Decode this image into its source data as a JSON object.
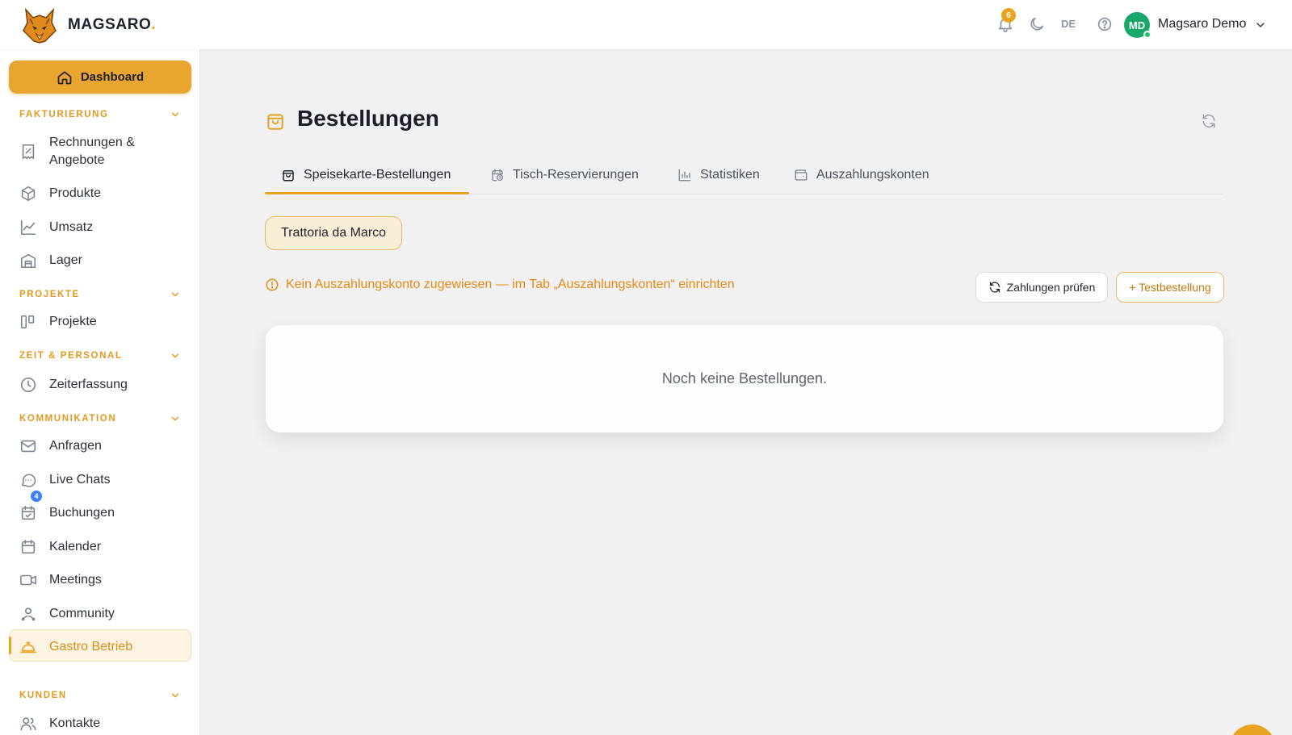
{
  "brand": {
    "name": "MAGSARO",
    "dot": ".",
    "logo_icon": "wolf-logo"
  },
  "topbar": {
    "notifications_count": "6",
    "language": "DE",
    "user_initials": "MD",
    "user_name": "Magsaro Demo"
  },
  "sidebar": {
    "dashboard_label": "Dashboard",
    "sections": {
      "fakturierung": "FAKTURIERUNG",
      "projekte": "PROJEKTE",
      "zeit": "ZEIT & PERSONAL",
      "kommunikation": "KOMMUNIKATION",
      "kunden": "KUNDEN"
    },
    "items": {
      "rechnungen_1": "Rechnungen &",
      "rechnungen_2": "Angebote",
      "produkte": "Produkte",
      "umsatz": "Umsatz",
      "lager": "Lager",
      "projekte": "Projekte",
      "zeiterfassung": "Zeiterfassung",
      "anfragen": "Anfragen",
      "anfragen_badge": "4",
      "live_chats": "Live Chats",
      "buchungen": "Buchungen",
      "kalender": "Kalender",
      "meetings": "Meetings",
      "community": "Community",
      "gastro": "Gastro Betrieb",
      "kontakte": "Kontakte"
    }
  },
  "main": {
    "title": "Bestellungen",
    "tabs": {
      "speisekarte": "Speisekarte-Bestellungen",
      "tisch": "Tisch-Reservierungen",
      "statistiken": "Statistiken",
      "auszahlung": "Auszahlungskonten"
    },
    "restaurant_chip": "Trattoria da Marco",
    "warning": "Kein Auszahlungskonto zugewiesen — im Tab „Auszahlungskonten“ einrichten",
    "btn_pay": "Zahlungen prüfen",
    "btn_test": "+ Testbestellung",
    "empty_text": "Noch keine Bestellungen."
  },
  "colors": {
    "accent": "#e8a320",
    "warning": "#e48a10",
    "avatar": "#18a86b",
    "badge_blue": "#3b82f6"
  }
}
